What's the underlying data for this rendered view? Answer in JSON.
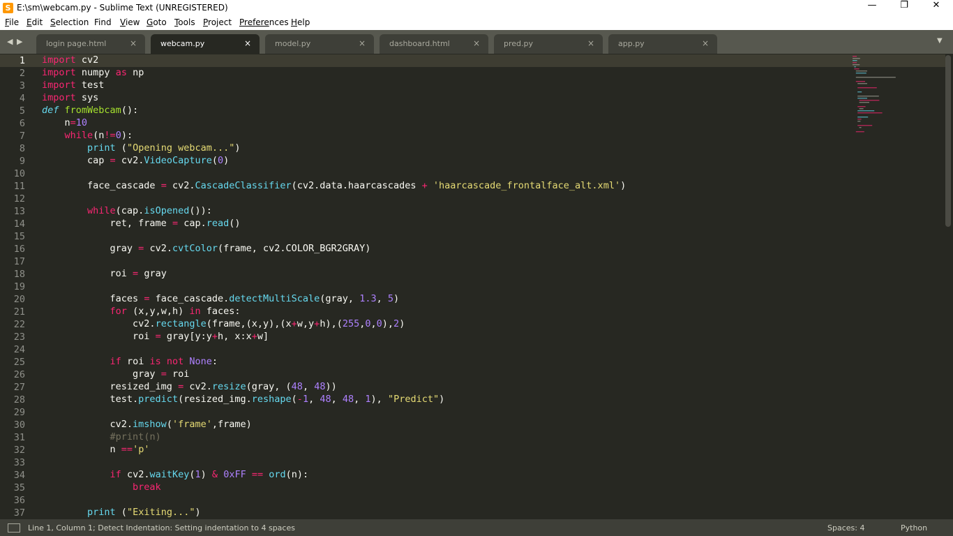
{
  "window": {
    "title": "E:\\sm\\webcam.py - Sublime Text (UNREGISTERED)",
    "minimize_glyph": "—",
    "maximize_glyph": "❐",
    "close_glyph": "✕"
  },
  "menu": [
    {
      "first": "F",
      "rest": "ile"
    },
    {
      "first": "E",
      "rest": "dit"
    },
    {
      "first": "S",
      "rest": "election"
    },
    {
      "first": "F",
      "rest": "ind",
      "first_plain": true
    },
    {
      "first": "V",
      "rest": "iew"
    },
    {
      "first": "G",
      "rest": "oto"
    },
    {
      "first": "T",
      "rest": "ools"
    },
    {
      "first": "P",
      "rest": "roject"
    },
    {
      "first": "Prefere",
      "rest": "nces"
    },
    {
      "first": "H",
      "rest": "elp"
    }
  ],
  "tabs": [
    {
      "label": "login page.html",
      "active": false
    },
    {
      "label": "webcam.py",
      "active": true
    },
    {
      "label": "model.py",
      "active": false
    },
    {
      "label": "dashboard.html",
      "active": false
    },
    {
      "label": "pred.py",
      "active": false
    },
    {
      "label": "app.py",
      "active": false
    }
  ],
  "tab_close_glyph": "×",
  "editor": {
    "current_line": 1,
    "lines": [
      {
        "n": "1",
        "html": "<span class='kw'>import</span> cv2"
      },
      {
        "n": "2",
        "html": "<span class='kw'>import</span> numpy <span class='kw'>as</span> np"
      },
      {
        "n": "3",
        "html": "<span class='kw'>import</span> test"
      },
      {
        "n": "4",
        "html": "<span class='kw'>import</span> sys"
      },
      {
        "n": "5",
        "html": "<span class='def'>def</span> <span class='name'>fromWebcam</span>():"
      },
      {
        "n": "6",
        "html": "    n<span class='kw'>=</span><span class='num'>10</span>"
      },
      {
        "n": "7",
        "html": "    <span class='kw'>while</span>(n<span class='kw'>!=</span><span class='num'>0</span>):"
      },
      {
        "n": "8",
        "html": "        <span class='fn'>print</span> (<span class='str'>\"Opening webcam...\"</span>)"
      },
      {
        "n": "9",
        "html": "        cap <span class='kw'>=</span> cv2.<span class='fn'>VideoCapture</span>(<span class='num'>0</span>)"
      },
      {
        "n": "10",
        "html": ""
      },
      {
        "n": "11",
        "html": "        face_cascade <span class='kw'>=</span> cv2.<span class='fn'>CascadeClassifier</span>(cv2.data.haarcascades <span class='kw'>+</span> <span class='str'>'haarcascade_frontalface_alt.xml'</span>)"
      },
      {
        "n": "12",
        "html": ""
      },
      {
        "n": "13",
        "html": "        <span class='kw'>while</span>(cap.<span class='fn'>isOpened</span>()):"
      },
      {
        "n": "14",
        "html": "            ret, frame <span class='kw'>=</span> cap.<span class='fn'>read</span>()"
      },
      {
        "n": "15",
        "html": ""
      },
      {
        "n": "16",
        "html": "            gray <span class='kw'>=</span> cv2.<span class='fn'>cvtColor</span>(frame, cv2.COLOR_BGR2GRAY)"
      },
      {
        "n": "17",
        "html": ""
      },
      {
        "n": "18",
        "html": "            roi <span class='kw'>=</span> gray"
      },
      {
        "n": "19",
        "html": ""
      },
      {
        "n": "20",
        "html": "            faces <span class='kw'>=</span> face_cascade.<span class='fn'>detectMultiScale</span>(gray, <span class='num'>1.3</span>, <span class='num'>5</span>)"
      },
      {
        "n": "21",
        "html": "            <span class='kw'>for</span> (x,y,w,h) <span class='kw'>in</span> faces:"
      },
      {
        "n": "22",
        "html": "                cv2.<span class='fn'>rectangle</span>(frame,(x,y),(x<span class='kw'>+</span>w,y<span class='kw'>+</span>h),(<span class='num'>255</span>,<span class='num'>0</span>,<span class='num'>0</span>),<span class='num'>2</span>)"
      },
      {
        "n": "23",
        "html": "                roi <span class='kw'>=</span> gray[y:y<span class='kw'>+</span>h, x:x<span class='kw'>+</span>w]"
      },
      {
        "n": "24",
        "html": ""
      },
      {
        "n": "25",
        "html": "            <span class='kw'>if</span> roi <span class='kw'>is</span> <span class='kw'>not</span> <span class='num'>None</span>:"
      },
      {
        "n": "26",
        "html": "                gray <span class='kw'>=</span> roi"
      },
      {
        "n": "27",
        "html": "            resized_img <span class='kw'>=</span> cv2.<span class='fn'>resize</span>(gray, (<span class='num'>48</span>, <span class='num'>48</span>))"
      },
      {
        "n": "28",
        "html": "            test.<span class='fn'>predict</span>(resized_img.<span class='fn'>reshape</span>(<span class='kw'>-</span><span class='num'>1</span>, <span class='num'>48</span>, <span class='num'>48</span>, <span class='num'>1</span>), <span class='str'>\"Predict\"</span>)"
      },
      {
        "n": "29",
        "html": ""
      },
      {
        "n": "30",
        "html": "            cv2.<span class='fn'>imshow</span>(<span class='str'>'frame'</span>,frame)"
      },
      {
        "n": "31",
        "html": "            <span class='cmt'>#print(n)</span>"
      },
      {
        "n": "32",
        "html": "            n <span class='kw'>==</span><span class='str'>'p'</span>"
      },
      {
        "n": "33",
        "html": ""
      },
      {
        "n": "34",
        "html": "            <span class='kw'>if</span> cv2.<span class='fn'>waitKey</span>(<span class='num'>1</span>) <span class='kw'>&amp;</span> <span class='num'>0xFF</span> <span class='kw'>==</span> <span class='fn'>ord</span>(n):"
      },
      {
        "n": "35",
        "html": "                <span class='kw'>break</span>"
      },
      {
        "n": "36",
        "html": ""
      },
      {
        "n": "37",
        "html": "        <span class='fn'>print</span> (<span class='str'>\"Exiting...\"</span>)"
      }
    ]
  },
  "status": {
    "message": "Line 1, Column 1; Detect Indentation: Setting indentation to 4 spaces",
    "indentation": "Spaces: 4",
    "syntax": "Python"
  },
  "colors": {
    "background": "#272822",
    "keyword": "#f92672",
    "function": "#66d9ef",
    "name": "#a6e22e",
    "number": "#ae81ff",
    "string": "#e6db74",
    "comment": "#75715e"
  }
}
